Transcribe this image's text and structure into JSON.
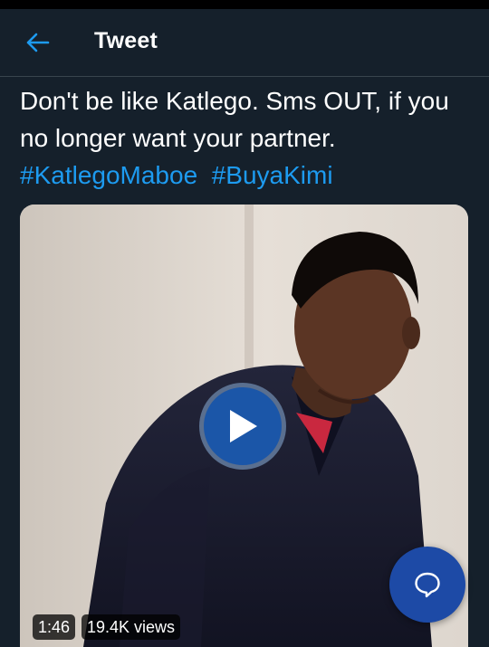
{
  "header": {
    "title": "Tweet",
    "back_icon": "arrow-left-icon",
    "accent": "#1d9bf0"
  },
  "tweet": {
    "text": "Don't be like Katlego. Sms OUT, if you no longer want your partner.",
    "hashtags": [
      "#KatlegoMaboe",
      "#BuyaKimi"
    ]
  },
  "video": {
    "duration": "1:46",
    "views": "19.4K views",
    "play_icon": "play-icon"
  },
  "fab": {
    "icon": "speech-bubble-icon",
    "color": "#1d4aa6"
  }
}
